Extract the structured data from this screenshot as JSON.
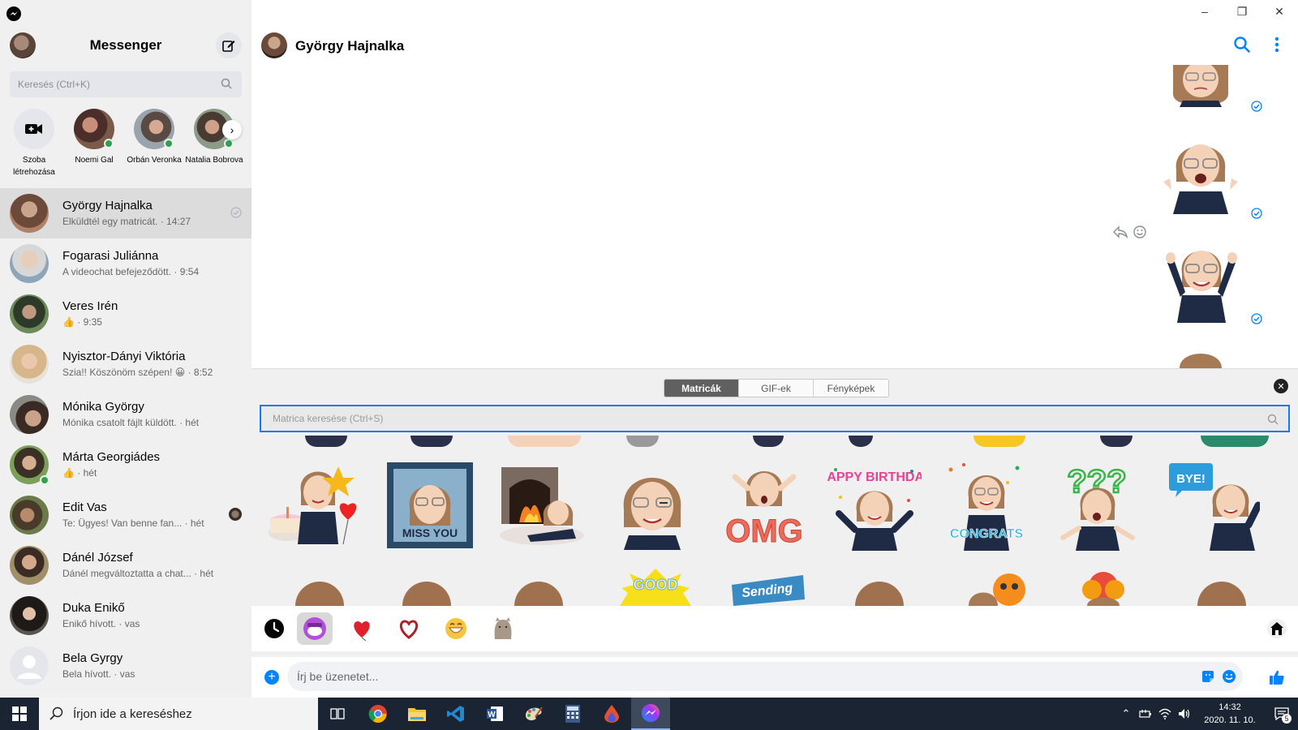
{
  "app": {
    "title": "Messenger"
  },
  "window": {
    "minimize": "–",
    "maximize": "❐",
    "close": "✕"
  },
  "sidebar": {
    "search_placeholder": "Keresés (Ctrl+K)",
    "stories": [
      {
        "label": "Szoba létrehozása"
      },
      {
        "label": "Noemi Gal"
      },
      {
        "label": "Orbán Veronka"
      },
      {
        "label": "Natalia Bobrova"
      }
    ],
    "conversations": [
      {
        "name": "György Hajnalka",
        "preview": "Elküldtél egy matricát. · 14:27"
      },
      {
        "name": "Fogarasi Juliánna",
        "preview": "A videochat befejeződött. · 9:54"
      },
      {
        "name": "Veres Irén",
        "preview": "👍 · 9:35"
      },
      {
        "name": "Nyisztor-Dányi Viktória",
        "preview": "Szia!! Köszönöm szépen! 😀 · 8:52"
      },
      {
        "name": "Mónika György",
        "preview": "Mónika csatolt fájlt küldött. · hét"
      },
      {
        "name": "Márta Georgiádes",
        "preview": "👍 · hét"
      },
      {
        "name": "Edit Vas",
        "preview": "Te: Ügyes! Van benne fan... · hét"
      },
      {
        "name": "Dánél József",
        "preview": "Dánél megváltoztatta a chat...  · hét"
      },
      {
        "name": "Duka Enikő",
        "preview": "Enikő hívott. · vas"
      },
      {
        "name": "Bela Gyrgy",
        "preview": "Bela hívott. · vas"
      }
    ]
  },
  "chat": {
    "title": "György Hajnalka",
    "composer_placeholder": "Írj be üzenetet..."
  },
  "sticker_panel": {
    "tabs": [
      {
        "label": "Matricák"
      },
      {
        "label": "GIF-ek"
      },
      {
        "label": "Fényképek"
      }
    ],
    "search_placeholder": "Matrica keresése (Ctrl+S)",
    "stickers": [
      {
        "label": ""
      },
      {
        "label": "MISS YOU"
      },
      {
        "label": ""
      },
      {
        "label": ""
      },
      {
        "label": "OMG"
      },
      {
        "label": "HAPPY BIRTHDAY"
      },
      {
        "label": "CONGRATS"
      },
      {
        "label": "???"
      },
      {
        "label": "BYE!"
      }
    ],
    "row2_labels": [
      "GOOD",
      "Sending"
    ]
  },
  "taskbar": {
    "search_placeholder": "Írjon ide a kereséshez",
    "time": "14:32",
    "date": "2020. 11. 10.",
    "notification_count": "5"
  },
  "colors": {
    "accent": "#0084ff",
    "sidebar_bg": "#f0f0f0",
    "taskbar_bg": "#1b2432",
    "online": "#31a24c"
  }
}
